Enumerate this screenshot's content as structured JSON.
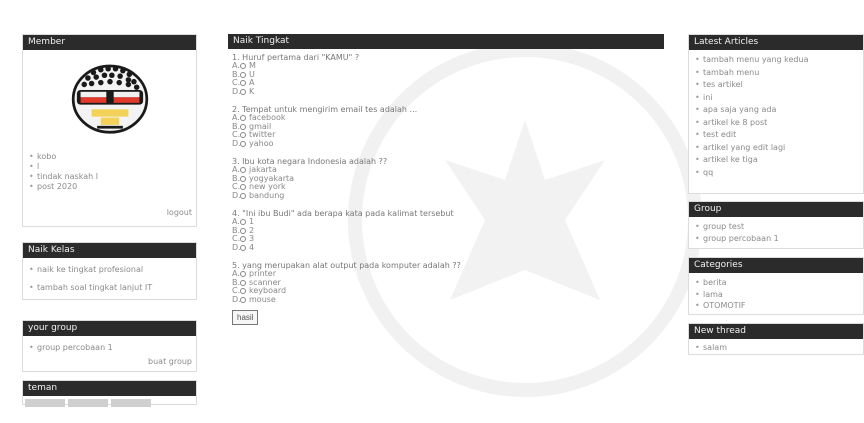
{
  "left": {
    "member": {
      "title": "Member",
      "items": [
        "kobo",
        "l",
        "tindak naskah l",
        "post 2020"
      ],
      "link": "logout"
    },
    "naik_kelas": {
      "title": "Naik Kelas",
      "items": [
        "naik ke tingkat profesional",
        "tambah soal tingkat lanjut IT"
      ]
    },
    "your_group": {
      "title": "your group",
      "items": [
        "group percobaan 1"
      ],
      "link": "buat group"
    },
    "teman": {
      "title": "teman"
    }
  },
  "main": {
    "title": "Naik Tingkat",
    "questions": [
      {
        "text": "1. Huruf pertama dari \"KAMU\" ?",
        "options": [
          {
            "letter": "A.",
            "text": "M"
          },
          {
            "letter": "B.",
            "text": "U"
          },
          {
            "letter": "C.",
            "text": "A"
          },
          {
            "letter": "D.",
            "text": "K"
          }
        ]
      },
      {
        "text": "2. Tempat untuk mengirim email tes adalah ...",
        "options": [
          {
            "letter": "A.",
            "text": "facebook"
          },
          {
            "letter": "B.",
            "text": "gmail"
          },
          {
            "letter": "C.",
            "text": "twitter"
          },
          {
            "letter": "D.",
            "text": "yahoo"
          }
        ]
      },
      {
        "text": "3. Ibu kota negara Indonesia adalah ??",
        "options": [
          {
            "letter": "A.",
            "text": "jakarta"
          },
          {
            "letter": "B.",
            "text": "yogyakarta"
          },
          {
            "letter": "C.",
            "text": "new york"
          },
          {
            "letter": "D.",
            "text": "bandung"
          }
        ]
      },
      {
        "text": "4. \"Ini ibu Budi\" ada berapa kata pada kalimat tersebut",
        "options": [
          {
            "letter": "A.",
            "text": "1"
          },
          {
            "letter": "B.",
            "text": "2"
          },
          {
            "letter": "C.",
            "text": "3"
          },
          {
            "letter": "D.",
            "text": "4"
          }
        ]
      },
      {
        "text": "5. yang merupakan alat output pada komputer adalah ??",
        "options": [
          {
            "letter": "A.",
            "text": "printer"
          },
          {
            "letter": "B.",
            "text": "scanner"
          },
          {
            "letter": "C.",
            "text": "keyboard"
          },
          {
            "letter": "D.",
            "text": "mouse"
          }
        ]
      }
    ],
    "submit": "hasil"
  },
  "right": {
    "latest": {
      "title": "Latest Articles",
      "items": [
        "tambah menu yang kedua",
        "tambah menu",
        "tes artikel",
        "ini",
        "apa saja yang ada",
        "artikel ke 8 post",
        "test edit",
        "artikel yang edit lagi",
        "artikel ke tiga",
        "qq"
      ]
    },
    "group": {
      "title": "Group",
      "items": [
        "group test",
        "group percobaan 1"
      ]
    },
    "categories": {
      "title": "Categories",
      "items": [
        "berita",
        "lama",
        "OTOMOTIF"
      ]
    },
    "new_thread": {
      "title": "New thread",
      "items": [
        "salam"
      ]
    }
  }
}
